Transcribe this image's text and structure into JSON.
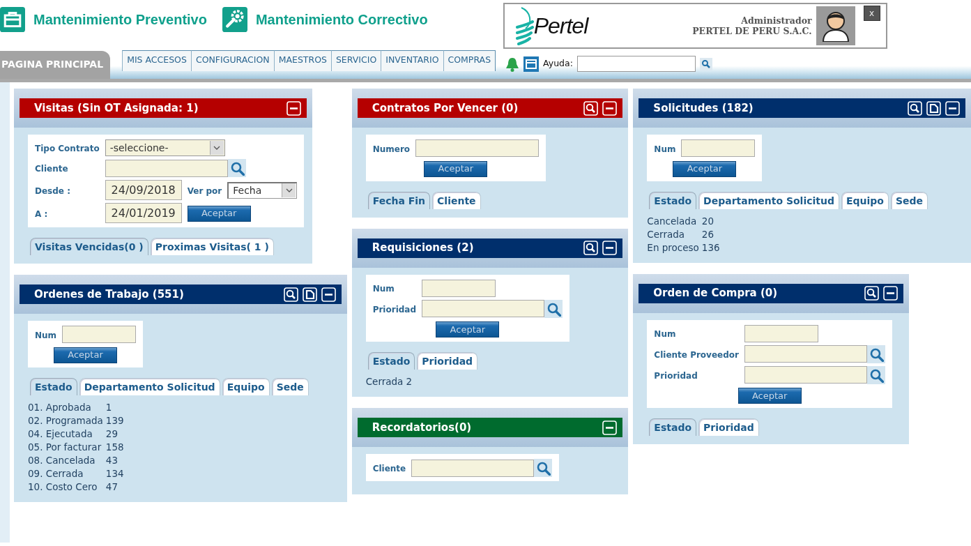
{
  "header": {
    "modules": [
      {
        "label": "Mantenimiento Preventivo"
      },
      {
        "label": "Mantenimiento Correctivo"
      }
    ],
    "brand": {
      "logo": "Pertel",
      "role": "Administrador",
      "company": "PERTEL DE PERU S.A.C.",
      "close": "x"
    }
  },
  "nav": {
    "items": [
      {
        "label": "PAGINA PRINCIPAL",
        "selected": true
      },
      {
        "label": "MIS ACCESOS",
        "selected": false
      },
      {
        "label": "CONFIGURACION",
        "selected": false
      },
      {
        "label": "MAESTROS",
        "selected": false
      },
      {
        "label": "SERVICIO",
        "selected": false
      },
      {
        "label": "INVENTARIO",
        "selected": false
      },
      {
        "label": "COMPRAS",
        "selected": false
      }
    ],
    "help": {
      "label": "Ayuda:"
    }
  },
  "columns": [
    {
      "panels": [
        {
          "title": "Visitas (Sin OT Asignada: 1)",
          "color": "#b50000",
          "actions": [
            {
              "kind": "collapse"
            }
          ],
          "form": [
            [
              {
                "kind": "label",
                "text": "Tipo Contrato"
              },
              {
                "kind": "select",
                "value": "-seleccione-"
              }
            ],
            [
              {
                "kind": "label",
                "text": "Cliente"
              },
              {
                "kind": "lookup"
              }
            ],
            [
              {
                "kind": "label",
                "text": "Desde :"
              },
              {
                "kind": "date",
                "value": "24/09/2018"
              },
              {
                "kind": "label",
                "text": "Ver por"
              },
              {
                "kind": "select",
                "value": "Fecha"
              }
            ],
            [
              {
                "kind": "label",
                "text": "A :"
              },
              {
                "kind": "date",
                "value": "24/01/2019"
              },
              {
                "kind": "button",
                "text": "Aceptar"
              }
            ]
          ],
          "tabs": [
            {
              "label": "Visitas Vencidas(0 )",
              "selected": true
            },
            {
              "label": "Proximas Visitas( 1 )",
              "selected": false
            }
          ]
        },
        {
          "title": "Ordenes de Trabajo (551)",
          "color": "#002f6c",
          "actions": [
            {
              "kind": "search"
            },
            {
              "kind": "new"
            },
            {
              "kind": "collapse"
            }
          ],
          "form": [
            [
              {
                "kind": "label",
                "text": "Num"
              },
              {
                "kind": "input"
              }
            ],
            [
              {
                "kind": "button",
                "text": "Aceptar"
              }
            ]
          ],
          "tabs": [
            {
              "label": "Estado",
              "selected": true
            },
            {
              "label": "Departamento Solicitud",
              "selected": false
            },
            {
              "label": "Equipo",
              "selected": false
            },
            {
              "label": "Sede",
              "selected": false
            }
          ],
          "stats": [
            {
              "label": "01. Aprobada",
              "count": "1"
            },
            {
              "label": "02. Programada",
              "count": "139"
            },
            {
              "label": "04. Ejecutada",
              "count": "29"
            },
            {
              "label": "05. Por facturar",
              "count": "158"
            },
            {
              "label": "08. Cancelada",
              "count": "43"
            },
            {
              "label": "09. Cerrada",
              "count": "134"
            },
            {
              "label": "10. Costo Cero",
              "count": "47"
            }
          ]
        }
      ]
    },
    {
      "panels": [
        {
          "title": "Contratos Por Vencer (0)",
          "color": "#b50000",
          "actions": [
            {
              "kind": "search"
            },
            {
              "kind": "collapse"
            }
          ],
          "form": [
            [
              {
                "kind": "label",
                "text": "Numero"
              },
              {
                "kind": "input"
              }
            ],
            [
              {
                "kind": "button",
                "text": "Aceptar"
              }
            ]
          ],
          "tabs": [
            {
              "label": "Fecha Fin",
              "selected": true
            },
            {
              "label": "Cliente",
              "selected": false
            }
          ]
        },
        {
          "title": "Requisiciones (2)",
          "color": "#002f6c",
          "actions": [
            {
              "kind": "search"
            },
            {
              "kind": "collapse"
            }
          ],
          "form": [
            [
              {
                "kind": "label",
                "text": "Num"
              },
              {
                "kind": "input"
              }
            ],
            [
              {
                "kind": "label",
                "text": "Prioridad"
              },
              {
                "kind": "lookup"
              }
            ],
            [
              {
                "kind": "button",
                "text": "Aceptar"
              }
            ]
          ],
          "tabs": [
            {
              "label": "Estado",
              "selected": true
            },
            {
              "label": "Prioridad",
              "selected": false
            }
          ],
          "stats": [
            {
              "label": "Cerrada",
              "count": "2"
            }
          ]
        },
        {
          "title": "Recordatorios(0)",
          "color": "#006b2e",
          "actions": [
            {
              "kind": "collapse"
            }
          ],
          "form": [
            [
              {
                "kind": "label",
                "text": "Cliente"
              },
              {
                "kind": "lookup"
              }
            ]
          ]
        }
      ]
    },
    {
      "panels": [
        {
          "title": "Solicitudes (182)",
          "color": "#002f6c",
          "actions": [
            {
              "kind": "search"
            },
            {
              "kind": "new"
            },
            {
              "kind": "collapse"
            }
          ],
          "form": [
            [
              {
                "kind": "label",
                "text": "Num"
              },
              {
                "kind": "input"
              }
            ],
            [
              {
                "kind": "button",
                "text": "Aceptar"
              }
            ]
          ],
          "tabs": [
            {
              "label": "Estado",
              "selected": true
            },
            {
              "label": "Departamento Solicitud",
              "selected": false
            },
            {
              "label": "Equipo",
              "selected": false
            },
            {
              "label": "Sede",
              "selected": false
            }
          ],
          "stats": [
            {
              "label": "Cancelada",
              "count": "20"
            },
            {
              "label": "Cerrada",
              "count": "26"
            },
            {
              "label": "En proceso",
              "count": "136"
            }
          ]
        },
        {
          "title": "Orden de Compra (0)",
          "color": "#002f6c",
          "actions": [
            {
              "kind": "search"
            },
            {
              "kind": "collapse"
            }
          ],
          "form": [
            [
              {
                "kind": "label",
                "text": "Num"
              },
              {
                "kind": "input"
              }
            ],
            [
              {
                "kind": "label",
                "text": "Cliente Proveedor"
              },
              {
                "kind": "lookup"
              }
            ],
            [
              {
                "kind": "label",
                "text": "Prioridad"
              },
              {
                "kind": "lookup"
              }
            ],
            [
              {
                "kind": "button",
                "text": "Aceptar"
              }
            ]
          ],
          "tabs": [
            {
              "label": "Estado",
              "selected": true
            },
            {
              "label": "Prioridad",
              "selected": false
            }
          ]
        }
      ]
    }
  ]
}
